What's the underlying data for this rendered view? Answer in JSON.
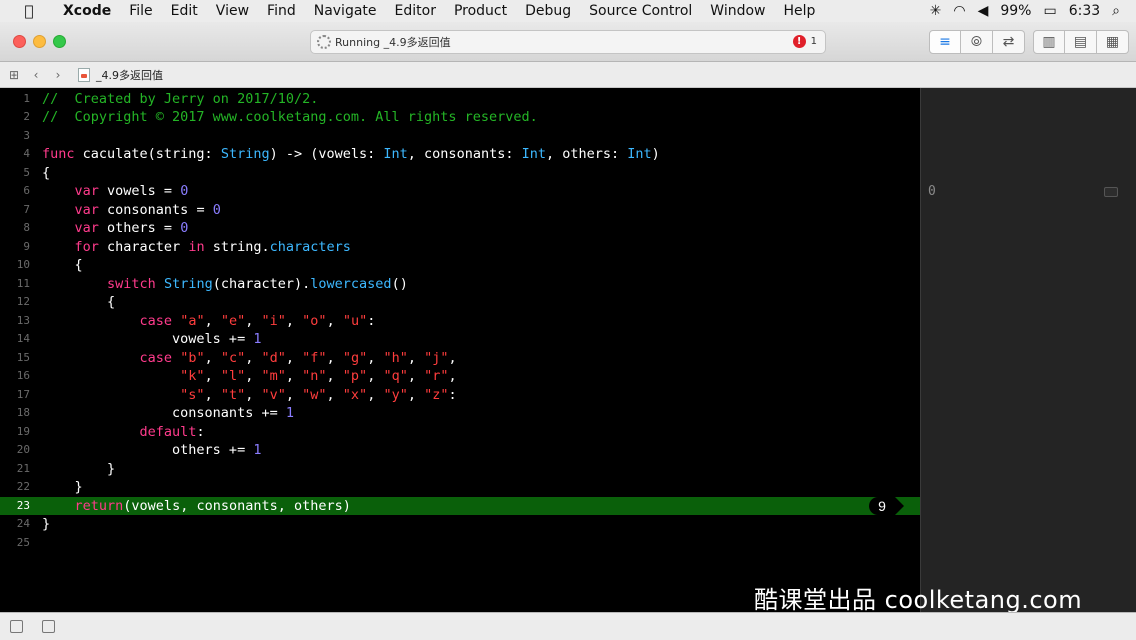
{
  "menubar": {
    "apple_icon": "apple-icon",
    "items": [
      "Xcode",
      "File",
      "Edit",
      "View",
      "Find",
      "Navigate",
      "Editor",
      "Product",
      "Debug",
      "Source Control",
      "Window",
      "Help"
    ],
    "battery": "99%",
    "time": "6:33",
    "status_icons": [
      "bluetooth-icon",
      "wifi-icon",
      "volume-icon",
      "battery-icon",
      "search-icon"
    ]
  },
  "toolbar": {
    "activity_status": "Running _4.9多返回值",
    "error_count": "1",
    "error_glyph": "!"
  },
  "jumpbar": {
    "file_name": "_4.9多返回值"
  },
  "editor": {
    "current_line": 23,
    "line_numbers": [
      "1",
      "2",
      "3",
      "4",
      "5",
      "6",
      "7",
      "8",
      "9",
      "10",
      "11",
      "12",
      "13",
      "14",
      "15",
      "16",
      "17",
      "18",
      "19",
      "20",
      "21",
      "22",
      "23",
      "24",
      "25"
    ],
    "lines": [
      [
        {
          "c": "c",
          "t": "//  Created by Jerry on 2017/10/2."
        }
      ],
      [
        {
          "c": "c",
          "t": "//  Copyright © 2017 www.coolketang.com. All rights reserved."
        }
      ],
      [],
      [
        {
          "c": "k",
          "t": "func"
        },
        {
          "c": "p",
          "t": " caculate(string: "
        },
        {
          "c": "t",
          "t": "String"
        },
        {
          "c": "p",
          "t": ") -> (vowels: "
        },
        {
          "c": "t",
          "t": "Int"
        },
        {
          "c": "p",
          "t": ", consonants: "
        },
        {
          "c": "t",
          "t": "Int"
        },
        {
          "c": "p",
          "t": ", others: "
        },
        {
          "c": "t",
          "t": "Int"
        },
        {
          "c": "p",
          "t": ")"
        }
      ],
      [
        {
          "c": "p",
          "t": "{"
        }
      ],
      [
        {
          "c": "p",
          "t": "    "
        },
        {
          "c": "k",
          "t": "var"
        },
        {
          "c": "p",
          "t": " vowels = "
        },
        {
          "c": "n",
          "t": "0"
        }
      ],
      [
        {
          "c": "p",
          "t": "    "
        },
        {
          "c": "k",
          "t": "var"
        },
        {
          "c": "p",
          "t": " consonants = "
        },
        {
          "c": "n",
          "t": "0"
        }
      ],
      [
        {
          "c": "p",
          "t": "    "
        },
        {
          "c": "k",
          "t": "var"
        },
        {
          "c": "p",
          "t": " others = "
        },
        {
          "c": "n",
          "t": "0"
        }
      ],
      [
        {
          "c": "p",
          "t": "    "
        },
        {
          "c": "k",
          "t": "for"
        },
        {
          "c": "p",
          "t": " character "
        },
        {
          "c": "k",
          "t": "in"
        },
        {
          "c": "p",
          "t": " string."
        },
        {
          "c": "t",
          "t": "characters"
        }
      ],
      [
        {
          "c": "p",
          "t": "    {"
        }
      ],
      [
        {
          "c": "p",
          "t": "        "
        },
        {
          "c": "k",
          "t": "switch"
        },
        {
          "c": "p",
          "t": " "
        },
        {
          "c": "t",
          "t": "String"
        },
        {
          "c": "p",
          "t": "(character)."
        },
        {
          "c": "t",
          "t": "lowercased"
        },
        {
          "c": "p",
          "t": "()"
        }
      ],
      [
        {
          "c": "p",
          "t": "        {"
        }
      ],
      [
        {
          "c": "p",
          "t": "            "
        },
        {
          "c": "k",
          "t": "case"
        },
        {
          "c": "p",
          "t": " "
        },
        {
          "c": "s",
          "t": "\"a\""
        },
        {
          "c": "p",
          "t": ", "
        },
        {
          "c": "s",
          "t": "\"e\""
        },
        {
          "c": "p",
          "t": ", "
        },
        {
          "c": "s",
          "t": "\"i\""
        },
        {
          "c": "p",
          "t": ", "
        },
        {
          "c": "s",
          "t": "\"o\""
        },
        {
          "c": "p",
          "t": ", "
        },
        {
          "c": "s",
          "t": "\"u\""
        },
        {
          "c": "p",
          "t": ":"
        }
      ],
      [
        {
          "c": "p",
          "t": "                vowels += "
        },
        {
          "c": "n",
          "t": "1"
        }
      ],
      [
        {
          "c": "p",
          "t": "            "
        },
        {
          "c": "k",
          "t": "case"
        },
        {
          "c": "p",
          "t": " "
        },
        {
          "c": "s",
          "t": "\"b\""
        },
        {
          "c": "p",
          "t": ", "
        },
        {
          "c": "s",
          "t": "\"c\""
        },
        {
          "c": "p",
          "t": ", "
        },
        {
          "c": "s",
          "t": "\"d\""
        },
        {
          "c": "p",
          "t": ", "
        },
        {
          "c": "s",
          "t": "\"f\""
        },
        {
          "c": "p",
          "t": ", "
        },
        {
          "c": "s",
          "t": "\"g\""
        },
        {
          "c": "p",
          "t": ", "
        },
        {
          "c": "s",
          "t": "\"h\""
        },
        {
          "c": "p",
          "t": ", "
        },
        {
          "c": "s",
          "t": "\"j\""
        },
        {
          "c": "p",
          "t": ","
        }
      ],
      [
        {
          "c": "p",
          "t": "                 "
        },
        {
          "c": "s",
          "t": "\"k\""
        },
        {
          "c": "p",
          "t": ", "
        },
        {
          "c": "s",
          "t": "\"l\""
        },
        {
          "c": "p",
          "t": ", "
        },
        {
          "c": "s",
          "t": "\"m\""
        },
        {
          "c": "p",
          "t": ", "
        },
        {
          "c": "s",
          "t": "\"n\""
        },
        {
          "c": "p",
          "t": ", "
        },
        {
          "c": "s",
          "t": "\"p\""
        },
        {
          "c": "p",
          "t": ", "
        },
        {
          "c": "s",
          "t": "\"q\""
        },
        {
          "c": "p",
          "t": ", "
        },
        {
          "c": "s",
          "t": "\"r\""
        },
        {
          "c": "p",
          "t": ","
        }
      ],
      [
        {
          "c": "p",
          "t": "                 "
        },
        {
          "c": "s",
          "t": "\"s\""
        },
        {
          "c": "p",
          "t": ", "
        },
        {
          "c": "s",
          "t": "\"t\""
        },
        {
          "c": "p",
          "t": ", "
        },
        {
          "c": "s",
          "t": "\"v\""
        },
        {
          "c": "p",
          "t": ", "
        },
        {
          "c": "s",
          "t": "\"w\""
        },
        {
          "c": "p",
          "t": ", "
        },
        {
          "c": "s",
          "t": "\"x\""
        },
        {
          "c": "p",
          "t": ", "
        },
        {
          "c": "s",
          "t": "\"y\""
        },
        {
          "c": "p",
          "t": ", "
        },
        {
          "c": "s",
          "t": "\"z\""
        },
        {
          "c": "p",
          "t": ":"
        }
      ],
      [
        {
          "c": "p",
          "t": "                consonants += "
        },
        {
          "c": "n",
          "t": "1"
        }
      ],
      [
        {
          "c": "p",
          "t": "            "
        },
        {
          "c": "k",
          "t": "default"
        },
        {
          "c": "p",
          "t": ":"
        }
      ],
      [
        {
          "c": "p",
          "t": "                others += "
        },
        {
          "c": "n",
          "t": "1"
        }
      ],
      [
        {
          "c": "p",
          "t": "        }"
        }
      ],
      [
        {
          "c": "p",
          "t": "    }"
        }
      ],
      [
        {
          "c": "p",
          "t": "    "
        },
        {
          "c": "k",
          "t": "return"
        },
        {
          "c": "p",
          "t": "(vowels, consonants, others)"
        }
      ],
      [
        {
          "c": "p",
          "t": "}"
        }
      ],
      []
    ],
    "execution_count": "9"
  },
  "results": {
    "value": "0"
  },
  "watermark": "酷课堂出品 coolketang.com",
  "colors": {
    "keyword": "#ff3b8c",
    "type": "#3db8ff",
    "string": "#ff3d3d",
    "number": "#8a7dff",
    "comment": "#24b526",
    "current_line": "#0a600a"
  }
}
